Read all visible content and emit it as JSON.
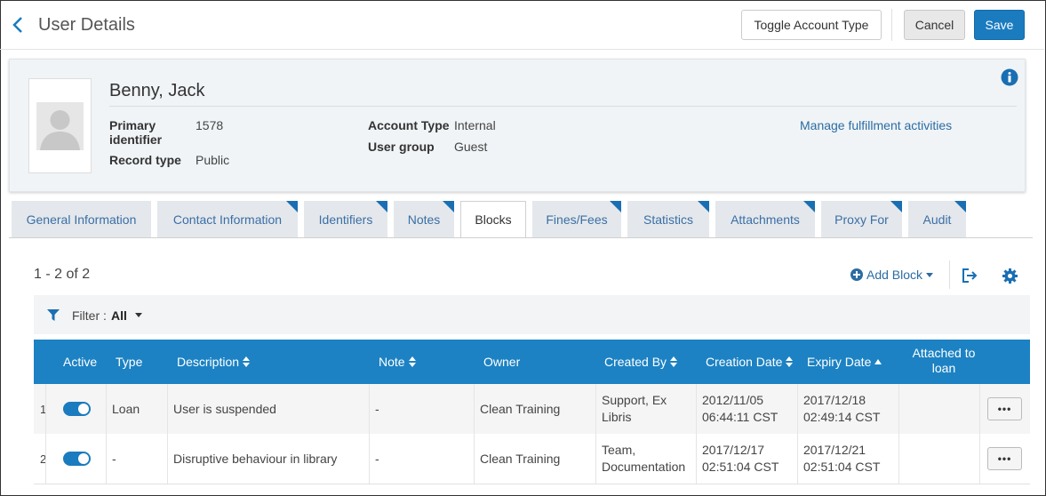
{
  "header": {
    "title": "User Details",
    "toggle_account_type": "Toggle Account Type",
    "cancel": "Cancel",
    "save": "Save"
  },
  "user": {
    "name": "Benny, Jack",
    "primary_identifier_label_1": "Primary",
    "primary_identifier_label_2": "identifier",
    "primary_identifier": "1578",
    "record_type_label": "Record type",
    "record_type": "Public",
    "account_type_label": "Account Type",
    "account_type": "Internal",
    "user_group_label": "User group",
    "user_group": "Guest",
    "manage_link": "Manage fulfillment activities"
  },
  "tabs": [
    {
      "label": "General Information"
    },
    {
      "label": "Contact Information"
    },
    {
      "label": "Identifiers"
    },
    {
      "label": "Notes"
    },
    {
      "label": "Blocks",
      "active": true
    },
    {
      "label": "Fines/Fees"
    },
    {
      "label": "Statistics"
    },
    {
      "label": "Attachments"
    },
    {
      "label": "Proxy For"
    },
    {
      "label": "Audit"
    }
  ],
  "list": {
    "count": "1 - 2 of 2",
    "add_block": "Add Block",
    "filter_label": "Filter :",
    "filter_value": "All"
  },
  "table": {
    "columns": {
      "active": "Active",
      "type": "Type",
      "description": "Description",
      "note": "Note",
      "owner": "Owner",
      "created_by": "Created By",
      "creation_date": "Creation Date",
      "expiry_date": "Expiry Date",
      "attached_1": "Attached to",
      "attached_2": "loan"
    },
    "rows": [
      {
        "index": "1",
        "active": true,
        "type": "Loan",
        "description": "User is suspended",
        "note": "-",
        "owner": "Clean Training",
        "created_by_1": "Support, Ex",
        "created_by_2": "Libris",
        "creation_date_1": "2012/11/05",
        "creation_date_2": "06:44:11 CST",
        "expiry_date_1": "2017/12/18",
        "expiry_date_2": "02:49:14 CST",
        "actions": "•••"
      },
      {
        "index": "2",
        "active": true,
        "type": "-",
        "description": "Disruptive behaviour in library",
        "note": "-",
        "owner": "Clean Training",
        "created_by_1": "Team,",
        "created_by_2": "Documentation",
        "creation_date_1": "2017/12/17",
        "creation_date_2": "02:51:04 CST",
        "expiry_date_1": "2017/12/21",
        "expiry_date_2": "02:51:04 CST",
        "actions": "•••"
      }
    ]
  },
  "colors": {
    "primary": "#1a7bbf",
    "table_header": "#1c82c3",
    "link": "#2b6ca3",
    "tab_corner": "#1a6fb3"
  }
}
